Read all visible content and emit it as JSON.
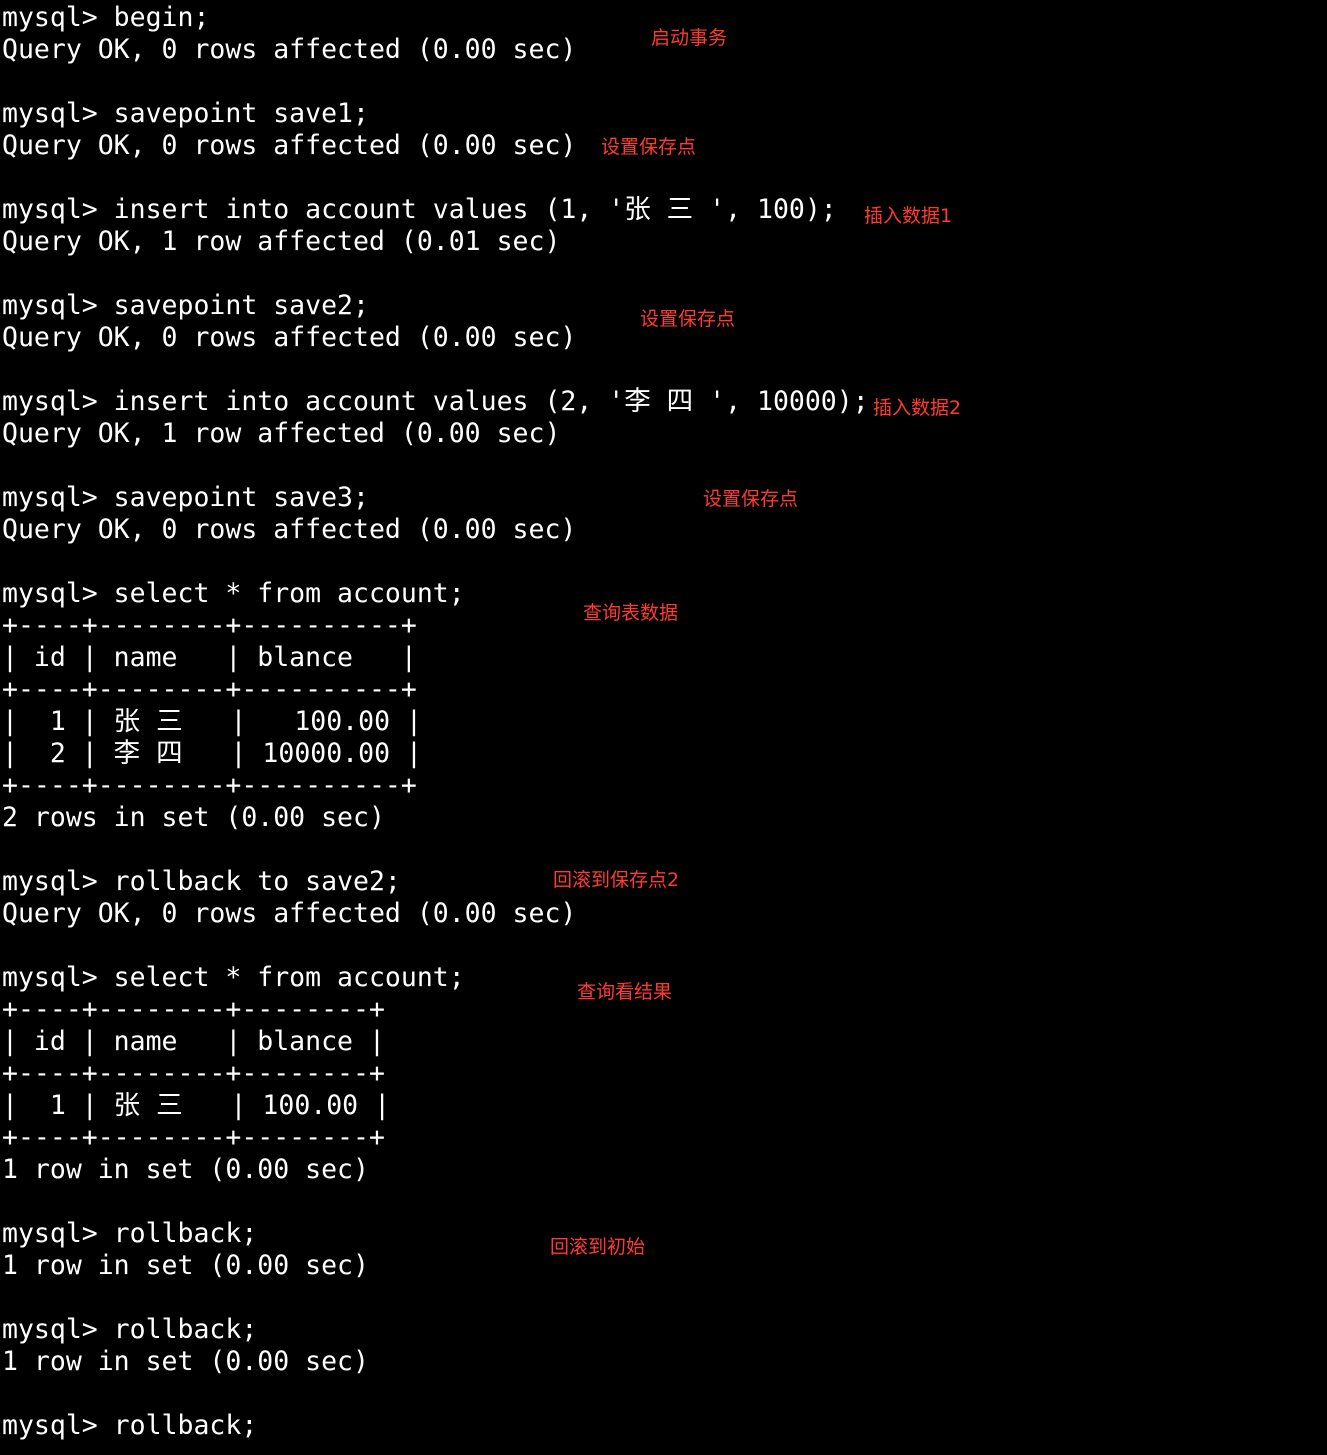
{
  "terminal": {
    "lines": [
      "mysql> begin;",
      "Query OK, 0 rows affected (0.00 sec)",
      "",
      "mysql> savepoint save1;",
      "Query OK, 0 rows affected (0.00 sec)",
      "",
      "mysql> insert into account values (1, '张 三 ', 100);",
      "Query OK, 1 row affected (0.01 sec)",
      "",
      "mysql> savepoint save2;",
      "Query OK, 0 rows affected (0.00 sec)",
      "",
      "mysql> insert into account values (2, '李 四 ', 10000);",
      "Query OK, 1 row affected (0.00 sec)",
      "",
      "mysql> savepoint save3;",
      "Query OK, 0 rows affected (0.00 sec)",
      "",
      "mysql> select * from account;",
      "+----+--------+----------+",
      "| id | name   | blance   |",
      "+----+--------+----------+",
      "|  1 | 张 三   |   100.00 |",
      "|  2 | 李 四   | 10000.00 |",
      "+----+--------+----------+",
      "2 rows in set (0.00 sec)",
      "",
      "mysql> rollback to save2;",
      "Query OK, 0 rows affected (0.00 sec)",
      "",
      "mysql> select * from account;",
      "+----+--------+--------+",
      "| id | name   | blance |",
      "+----+--------+--------+",
      "|  1 | 张 三   | 100.00 |",
      "+----+--------+--------+",
      "1 row in set (0.00 sec)",
      "",
      "mysql> rollback;",
      "1 row in set (0.00 sec)",
      "",
      "mysql> rollback;",
      "1 row in set (0.00 sec)",
      "",
      "mysql> rollback;"
    ]
  },
  "annotations": {
    "begin": "启动事务",
    "save1": "设置保存点",
    "insert1": "插入数据1",
    "save2": "设置保存点",
    "insert2": "插入数据2",
    "save3": "设置保存点",
    "select1": "查询表数据",
    "rollback_to_save2": "回滚到保存点2",
    "select2": "查询看结果",
    "rollback_initial": "回滚到初始"
  },
  "colors": {
    "background": "#000000",
    "text": "#ffffff",
    "annotation": "#ff3b30"
  }
}
